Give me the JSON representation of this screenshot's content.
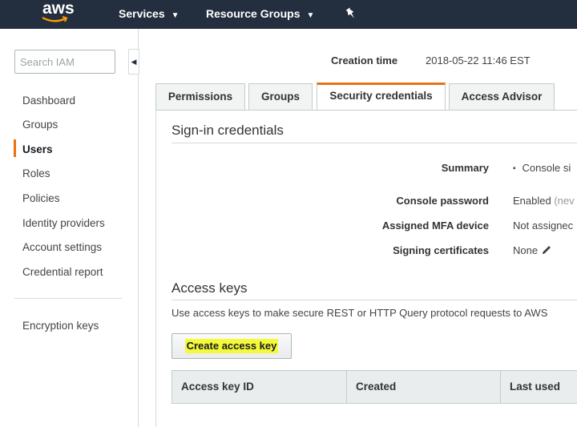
{
  "topbar": {
    "logo_text": "aws",
    "nav": [
      {
        "label": "Services"
      },
      {
        "label": "Resource Groups"
      }
    ]
  },
  "sidebar": {
    "search_placeholder": "Search IAM",
    "items": [
      {
        "label": "Dashboard"
      },
      {
        "label": "Groups"
      },
      {
        "label": "Users"
      },
      {
        "label": "Roles"
      },
      {
        "label": "Policies"
      },
      {
        "label": "Identity providers"
      },
      {
        "label": "Account settings"
      },
      {
        "label": "Credential report"
      }
    ],
    "secondary_items": [
      {
        "label": "Encryption keys"
      }
    ],
    "active_item": "Users"
  },
  "header": {
    "creation_label": "Creation time",
    "creation_value": "2018-05-22 11:46 EST"
  },
  "tabs": [
    {
      "label": "Permissions"
    },
    {
      "label": "Groups"
    },
    {
      "label": "Security credentials"
    },
    {
      "label": "Access Advisor"
    }
  ],
  "active_tab": "Security credentials",
  "signin": {
    "title": "Sign-in credentials",
    "rows": [
      {
        "label": "Summary",
        "value": "Console si"
      },
      {
        "label": "Console password",
        "value": "Enabled",
        "value_muted": "(nev"
      },
      {
        "label": "Assigned MFA device",
        "value": "Not assignec"
      },
      {
        "label": "Signing certificates",
        "value": "None"
      }
    ]
  },
  "access_keys": {
    "title": "Access keys",
    "description": "Use access keys to make secure REST or HTTP Query protocol requests to AWS",
    "create_button": "Create access key",
    "columns": [
      "Access key ID",
      "Created",
      "Last used"
    ]
  },
  "colors": {
    "topbar": "#232f3e",
    "accent": "#ec7211",
    "highlight": "#f4f93a"
  },
  "icons": [
    "aws-smile-logo",
    "caret-down-icon",
    "pin-icon",
    "collapse-left-icon",
    "pencil-icon"
  ]
}
